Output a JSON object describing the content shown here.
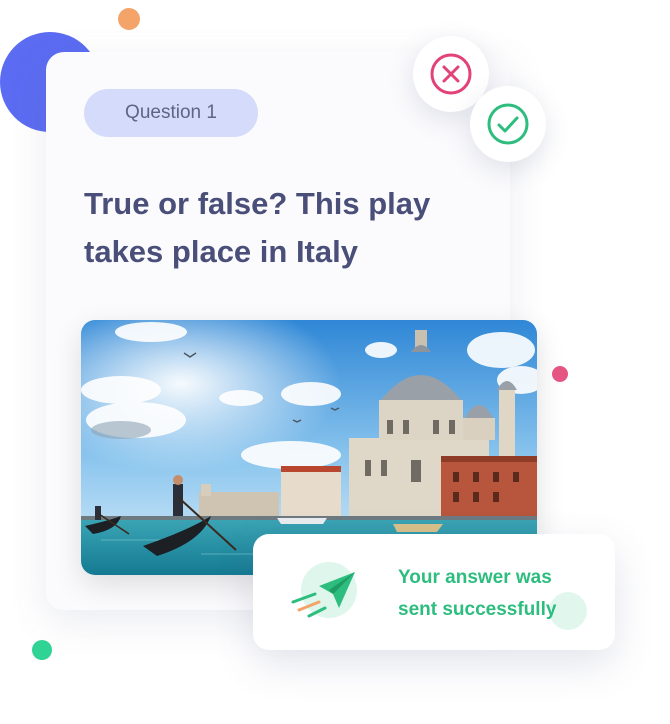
{
  "quiz": {
    "badge_label": "Question 1",
    "question_text": "True or false? This play takes place in Italy"
  },
  "answers": {
    "false_icon": "x-icon",
    "true_icon": "check-icon"
  },
  "image": {
    "subject": "venice-grand-canal-photo"
  },
  "toast": {
    "line1": "Your answer was",
    "line2": "sent successfully",
    "icon": "paper-plane-icon"
  },
  "colors": {
    "question_text": "#4a4f7a",
    "badge_bg": "#d5dbfb",
    "false_red": "#e34278",
    "true_green": "#2dbd7e",
    "accent_blue": "#5b6cf2",
    "accent_orange": "#f4a468",
    "accent_pink": "#e45584",
    "accent_green": "#2fd394"
  }
}
